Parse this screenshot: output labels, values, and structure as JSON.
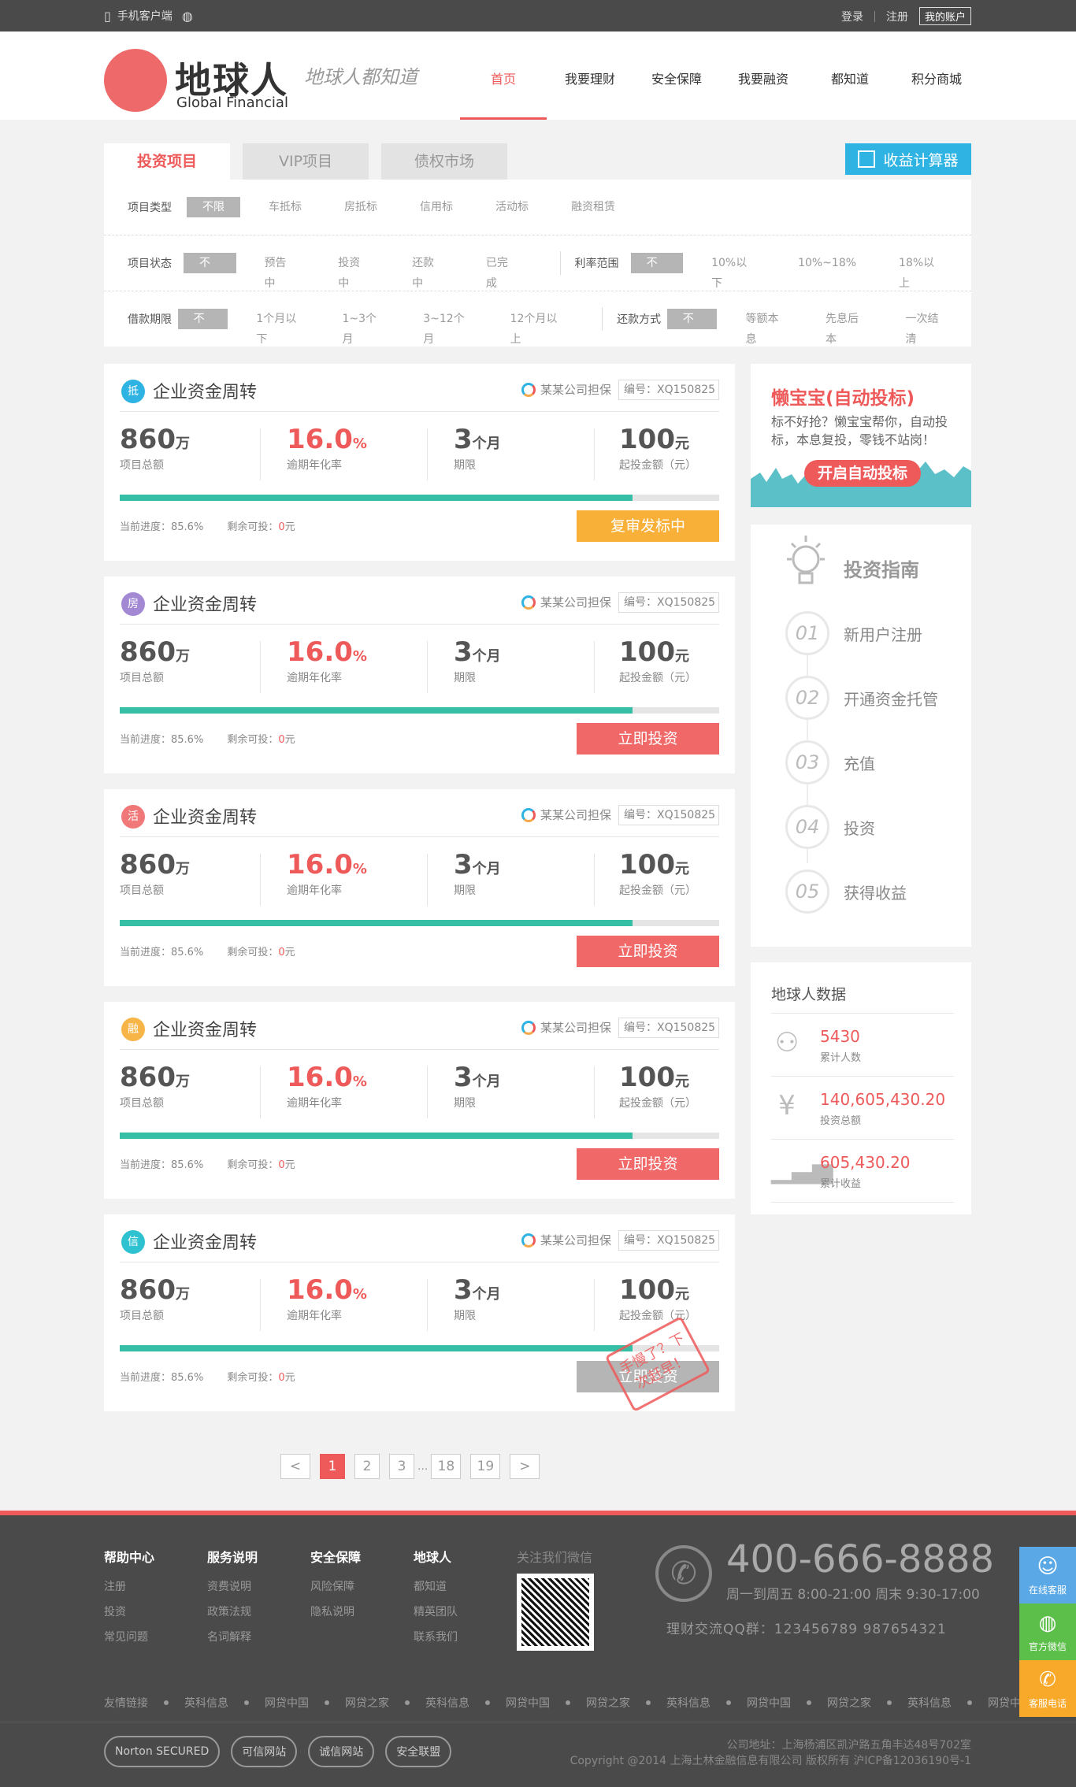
{
  "topbar": {
    "mobile": "手机客户端",
    "login": "登录",
    "register": "注册",
    "account": "我的账户"
  },
  "header": {
    "logo_cn": "地球人",
    "logo_en": "Global Financial",
    "slogan": "地球人都知道",
    "nav": [
      "首页",
      "我要理财",
      "安全保障",
      "我要融资",
      "都知道",
      "积分商城"
    ]
  },
  "tabs": [
    "投资项目",
    "VIP项目",
    "债权市场"
  ],
  "calc": "收益计算器",
  "filters": {
    "type": {
      "label": "项目类型",
      "options": [
        "不限",
        "车抵标",
        "房抵标",
        "信用标",
        "活动标",
        "融资租赁"
      ]
    },
    "status": {
      "label": "项目状态",
      "options": [
        "不限",
        "预告中",
        "投资中",
        "还款中",
        "已完成"
      ]
    },
    "rate": {
      "label": "利率范围",
      "options": [
        "不限",
        "10%以下",
        "10%~18%",
        "18%以上"
      ]
    },
    "term": {
      "label": "借款期限",
      "options": [
        "不限",
        "1个月以下",
        "1~3个月",
        "3~12个月",
        "12个月以上"
      ]
    },
    "repay": {
      "label": "还款方式",
      "options": [
        "不限",
        "等额本息",
        "先息后本",
        "一次结清"
      ]
    }
  },
  "cards": [
    {
      "badge": "抵",
      "badge_color": "#2eb3e3",
      "title": "企业资金周转",
      "guarantor": "某某公司担保",
      "serial": "编号：XQ150825",
      "amount": "860",
      "amount_unit": "万",
      "amount_label": "项目总额",
      "rate": "16.0",
      "rate_unit": "%",
      "rate_label": "逾期年化率",
      "term": "3",
      "term_unit": "个月",
      "term_label": "期限",
      "min": "100",
      "min_unit": "元",
      "min_label": "起投金额（元）",
      "progress": 0.856,
      "progress_text": "当前进度：85.6%",
      "remain_label": "剩余可投：",
      "remain": "0",
      "remain_unit": "元",
      "action": "复审发标中",
      "action_color": "#f8b039"
    },
    {
      "badge": "房",
      "badge_color": "#a389d4",
      "title": "企业资金周转",
      "guarantor": "某某公司担保",
      "serial": "编号：XQ150825",
      "amount": "860",
      "amount_unit": "万",
      "amount_label": "项目总额",
      "rate": "16.0",
      "rate_unit": "%",
      "rate_label": "逾期年化率",
      "term": "3",
      "term_unit": "个月",
      "term_label": "期限",
      "min": "100",
      "min_unit": "元",
      "min_label": "起投金额（元）",
      "progress": 0.856,
      "progress_text": "当前进度：85.6%",
      "remain_label": "剩余可投：",
      "remain": "0",
      "remain_unit": "元",
      "action": "立即投资",
      "action_color": "#f06868"
    },
    {
      "badge": "活",
      "badge_color": "#f07878",
      "title": "企业资金周转",
      "guarantor": "某某公司担保",
      "serial": "编号：XQ150825",
      "amount": "860",
      "amount_unit": "万",
      "amount_label": "项目总额",
      "rate": "16.0",
      "rate_unit": "%",
      "rate_label": "逾期年化率",
      "term": "3",
      "term_unit": "个月",
      "term_label": "期限",
      "min": "100",
      "min_unit": "元",
      "min_label": "起投金额（元）",
      "progress": 0.856,
      "progress_text": "当前进度：85.6%",
      "remain_label": "剩余可投：",
      "remain": "0",
      "remain_unit": "元",
      "action": "立即投资",
      "action_color": "#f06868"
    },
    {
      "badge": "融",
      "badge_color": "#f7b548",
      "title": "企业资金周转",
      "guarantor": "某某公司担保",
      "serial": "编号：XQ150825",
      "amount": "860",
      "amount_unit": "万",
      "amount_label": "项目总额",
      "rate": "16.0",
      "rate_unit": "%",
      "rate_label": "逾期年化率",
      "term": "3",
      "term_unit": "个月",
      "term_label": "期限",
      "min": "100",
      "min_unit": "元",
      "min_label": "起投金额（元）",
      "progress": 0.856,
      "progress_text": "当前进度：85.6%",
      "remain_label": "剩余可投：",
      "remain": "0",
      "remain_unit": "元",
      "action": "立即投资",
      "action_color": "#f06868"
    },
    {
      "badge": "信",
      "badge_color": "#2ec2d0",
      "title": "企业资金周转",
      "guarantor": "某某公司担保",
      "serial": "编号：XQ150825",
      "amount": "860",
      "amount_unit": "万",
      "amount_label": "项目总额",
      "rate": "16.0",
      "rate_unit": "%",
      "rate_label": "逾期年化率",
      "term": "3",
      "term_unit": "个月",
      "term_label": "期限",
      "min": "100",
      "min_unit": "元",
      "min_label": "起投金额（元）",
      "progress": 0.856,
      "progress_text": "当前进度：85.6%",
      "remain_label": "剩余可投：",
      "remain": "0",
      "remain_unit": "元",
      "action": "立即投资",
      "action_color": "#b5b5b5",
      "stamp": "手慢了？下次赶早！"
    }
  ],
  "auto": {
    "title": "懒宝宝(自动投标)",
    "desc": "标不好抢？懒宝宝帮你，自动投标，本息复投，零钱不站岗！",
    "button": "开启自动投标"
  },
  "guide": {
    "title": "投资指南",
    "steps": [
      {
        "n": "01",
        "t": "新用户注册"
      },
      {
        "n": "02",
        "t": "开通资金托管"
      },
      {
        "n": "03",
        "t": "充值"
      },
      {
        "n": "04",
        "t": "投资"
      },
      {
        "n": "05",
        "t": "获得收益"
      }
    ]
  },
  "stats": {
    "title": "地球人数据",
    "items": [
      {
        "icon": "user-icon",
        "value": "5430",
        "label": "累计人数"
      },
      {
        "icon": "yen-icon",
        "value": "140,605,430.20",
        "label": "投资总额"
      },
      {
        "icon": "bar-chart-icon",
        "value": "605,430.20",
        "label": "累计收益"
      }
    ]
  },
  "pager": {
    "prev": "<",
    "pages": [
      "1",
      "2",
      "3"
    ],
    "ellipsis": "...",
    "last": [
      "18",
      "19"
    ],
    "next": ">"
  },
  "footer": {
    "cols": [
      {
        "h": "帮助中心",
        "a": [
          "注册",
          "投资",
          "常见问题"
        ]
      },
      {
        "h": "服务说明",
        "a": [
          "资费说明",
          "政策法规",
          "名词解释"
        ]
      },
      {
        "h": "安全保障",
        "a": [
          "风险保障",
          "隐私说明"
        ]
      },
      {
        "h": "地球人",
        "a": [
          "都知道",
          "精英团队",
          "联系我们"
        ]
      }
    ],
    "wechat": "关注我们微信",
    "phone": "400-666-8888",
    "hours": "周一到周五  8:00-21:00  周末 9:30-17:00",
    "qq": "理财交流QQ群：123456789    987654321",
    "links": [
      "友情链接",
      "英科信息",
      "网贷中国",
      "网贷之家",
      "英科信息",
      "网贷中国",
      "网贷之家",
      "英科信息",
      "网贷中国",
      "网贷之家",
      "英科信息",
      "网贷中国"
    ],
    "seals": [
      "Norton SECURED",
      "可信网站",
      "诚信网站",
      "安全联盟"
    ],
    "address": "公司地址：上海杨浦区凯沪路五角丰达48号702室",
    "copyright": "Copyright @2014 上海土林金融信息有限公司 版权所有  沪ICP备12036190号-1"
  },
  "float": [
    {
      "label": "在线客服",
      "color": "#5aa9e6"
    },
    {
      "label": "官方微信",
      "color": "#5cbf4a"
    },
    {
      "label": "客服电话",
      "color": "#f8a92a"
    }
  ]
}
